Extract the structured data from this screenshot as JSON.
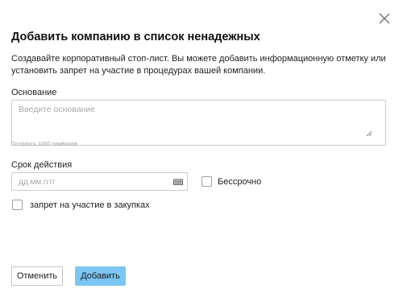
{
  "dialog": {
    "title": "Добавить компанию в список ненадежных",
    "description": "Создавайте корпоративный стоп-лист. Вы можете добавить информационную отметку или установить запрет на участие в процедурах вашей компании."
  },
  "reason": {
    "label": "Основание",
    "placeholder": "Введите основание",
    "value": "",
    "counter": "Осталось 1000 символов"
  },
  "validity": {
    "label": "Срок действия",
    "date_placeholder": "дд.мм.гггг",
    "date_value": "",
    "indefinite_label": "Бессрочно",
    "indefinite_checked": false
  },
  "ban": {
    "label": "запрет на участие в закупках",
    "checked": false
  },
  "buttons": {
    "cancel": "Отменить",
    "add": "Добавить"
  },
  "icons": {
    "close": "close-icon",
    "calendar": "calendar-icon",
    "resize": "resize-handle-icon"
  },
  "colors": {
    "primary_button": "#7cc6f4",
    "border": "#c8cbd0",
    "placeholder": "#a6a9ad"
  }
}
